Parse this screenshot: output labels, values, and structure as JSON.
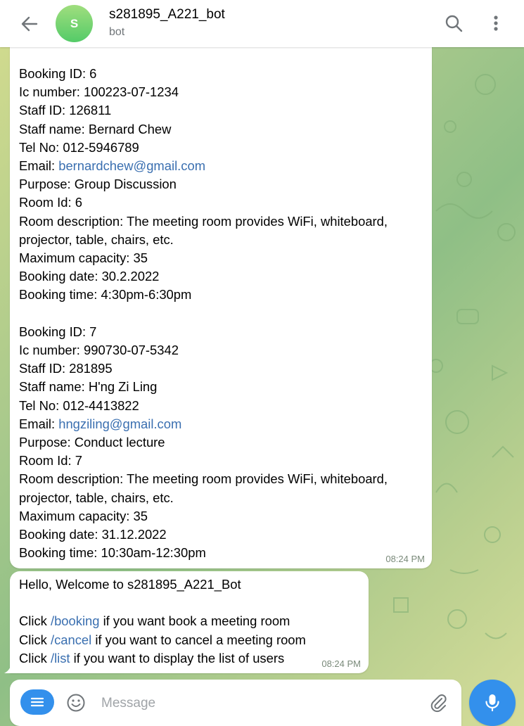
{
  "header": {
    "avatar_letter": "S",
    "title": "s281895_A221_bot",
    "subtitle": "bot"
  },
  "messages": [
    {
      "bookings": [
        {
          "booking_id": "Booking ID: 6",
          "ic_number": "Ic number: 100223-07-1234",
          "staff_id": "Staff ID: 126811",
          "staff_name": "Staff name: Bernard Chew",
          "tel": "Tel No: 012-5946789",
          "email_label": "Email: ",
          "email": "bernardchew@gmail.com",
          "purpose": "Purpose: Group Discussion",
          "room_id": "Room Id: 6",
          "room_desc_1": "Room description: The meeting room provides WiFi, whiteboard,",
          "room_desc_2": "projector, table, chairs, etc.",
          "capacity": "Maximum capacity: 35",
          "date": "Booking date: 30.2.2022",
          "time": "Booking time: 4:30pm-6:30pm"
        },
        {
          "booking_id": "Booking ID: 7",
          "ic_number": "Ic number: 990730-07-5342",
          "staff_id": "Staff ID: 281895",
          "staff_name": "Staff name: H'ng Zi Ling",
          "tel": "Tel No: 012-4413822",
          "email_label": "Email: ",
          "email": "hngziling@gmail.com",
          "purpose": "Purpose: Conduct lecture",
          "room_id": "Room Id: 7",
          "room_desc_1": "Room description: The meeting room provides WiFi, whiteboard,",
          "room_desc_2": "projector, table, chairs, etc.",
          "capacity": "Maximum capacity: 35",
          "date": "Booking date: 31.12.2022",
          "time": "Booking time: 10:30am-12:30pm"
        }
      ],
      "timestamp": "08:24 PM"
    },
    {
      "greeting": "Hello, Welcome to s281895_A221_Bot",
      "line1_pre": "Click ",
      "line1_cmd": "/booking",
      "line1_post": " if you want book a meeting room",
      "line2_pre": "Click ",
      "line2_cmd": "/cancel",
      "line2_post": " if you want to cancel a meeting room",
      "line3_pre": "Click ",
      "line3_cmd": "/list",
      "line3_post": " if you want to display the list of users",
      "timestamp": "08:24 PM"
    }
  ],
  "composer": {
    "placeholder": "Message"
  },
  "colors": {
    "accent": "#3390ec",
    "link": "#3a6fb0",
    "avatar_green": "#54cb68"
  }
}
